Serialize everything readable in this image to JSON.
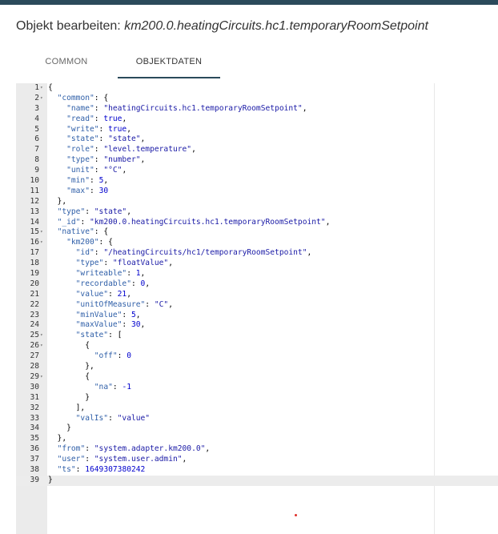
{
  "dialog": {
    "title_prefix": "Objekt bearbeiten:",
    "object_id": "km200.0.heatingCircuits.hc1.temporaryRoomSetpoint"
  },
  "tabs": [
    {
      "label": "COMMON"
    },
    {
      "label": "OBJEKTDATEN"
    }
  ],
  "colors": {
    "key": "#2f5fa8",
    "string": "#1a1aa6",
    "number": "#0000cd",
    "bool": "#0000cd",
    "punct": "#000000",
    "accent": "#2b4a5b"
  },
  "editor": {
    "active_line": 39,
    "lines": [
      {
        "n": "1",
        "fold": true,
        "text": "{"
      },
      {
        "n": "2",
        "fold": true,
        "text": "  \"common\": {"
      },
      {
        "n": "3",
        "text": "    \"name\": \"heatingCircuits.hc1.temporaryRoomSetpoint\","
      },
      {
        "n": "4",
        "text": "    \"read\": true,"
      },
      {
        "n": "5",
        "text": "    \"write\": true,"
      },
      {
        "n": "6",
        "text": "    \"state\": \"state\","
      },
      {
        "n": "7",
        "text": "    \"role\": \"level.temperature\","
      },
      {
        "n": "8",
        "text": "    \"type\": \"number\","
      },
      {
        "n": "9",
        "text": "    \"unit\": \"°C\","
      },
      {
        "n": "10",
        "text": "    \"min\": 5,"
      },
      {
        "n": "11",
        "text": "    \"max\": 30"
      },
      {
        "n": "12",
        "text": "  },"
      },
      {
        "n": "13",
        "text": "  \"type\": \"state\","
      },
      {
        "n": "14",
        "text": "  \"_id\": \"km200.0.heatingCircuits.hc1.temporaryRoomSetpoint\","
      },
      {
        "n": "15",
        "fold": true,
        "text": "  \"native\": {"
      },
      {
        "n": "16",
        "fold": true,
        "text": "    \"km200\": {"
      },
      {
        "n": "17",
        "text": "      \"id\": \"/heatingCircuits/hc1/temporaryRoomSetpoint\","
      },
      {
        "n": "18",
        "text": "      \"type\": \"floatValue\","
      },
      {
        "n": "19",
        "text": "      \"writeable\": 1,"
      },
      {
        "n": "20",
        "text": "      \"recordable\": 0,"
      },
      {
        "n": "21",
        "text": "      \"value\": 21,"
      },
      {
        "n": "22",
        "text": "      \"unitOfMeasure\": \"C\","
      },
      {
        "n": "23",
        "text": "      \"minValue\": 5,"
      },
      {
        "n": "24",
        "text": "      \"maxValue\": 30,"
      },
      {
        "n": "25",
        "fold": true,
        "text": "      \"state\": ["
      },
      {
        "n": "26",
        "fold": true,
        "text": "        {"
      },
      {
        "n": "27",
        "text": "          \"off\": 0"
      },
      {
        "n": "28",
        "text": "        },"
      },
      {
        "n": "29",
        "fold": true,
        "text": "        {"
      },
      {
        "n": "30",
        "text": "          \"na\": -1"
      },
      {
        "n": "31",
        "text": "        }"
      },
      {
        "n": "32",
        "text": "      ],"
      },
      {
        "n": "33",
        "text": "      \"valIs\": \"value\""
      },
      {
        "n": "34",
        "text": "    }"
      },
      {
        "n": "35",
        "text": "  },"
      },
      {
        "n": "36",
        "text": "  \"from\": \"system.adapter.km200.0\","
      },
      {
        "n": "37",
        "text": "  \"user\": \"system.user.admin\","
      },
      {
        "n": "38",
        "text": "  \"ts\": 1649307380242"
      },
      {
        "n": "39",
        "text": "}"
      }
    ]
  }
}
